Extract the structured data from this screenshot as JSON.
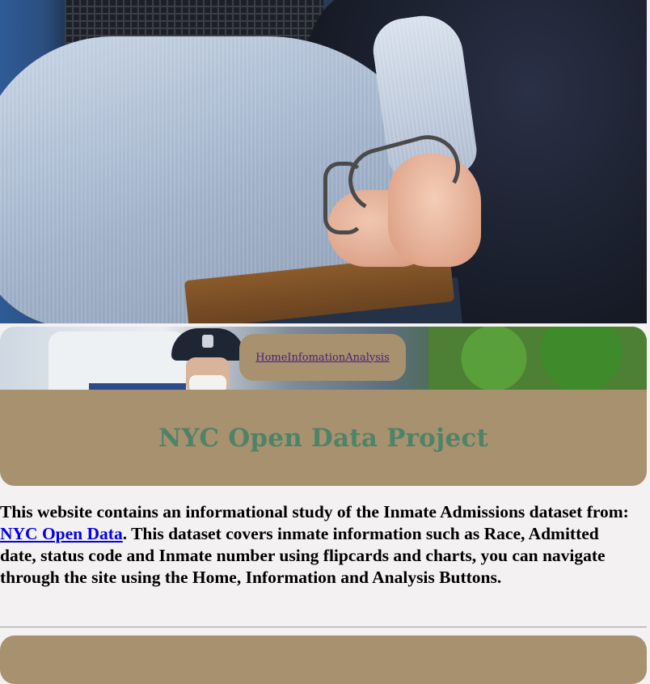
{
  "nav": {
    "links": [
      "Home",
      "Infomation",
      "Analysis"
    ]
  },
  "header": {
    "title": "NYC Open Data Project"
  },
  "intro": {
    "before_link": "This website contains an informational study of the Inmate Admissions dataset from: ",
    "link_text": "NYC Open Data",
    "after_link": ". This dataset covers inmate information such as Race, Admitted date, status code and Inmate number using flipcards and charts, you can navigate through the site using the Home, Information and Analysis Buttons."
  },
  "colors": {
    "background": "#f3f1f1",
    "panel": "#a8916f",
    "title_text": "#4f8368",
    "nav_link": "#4b1b7f",
    "body_link": "#0000ee"
  },
  "images": {
    "hero": "arrest-photo",
    "nav_banner": "police-street-photo"
  }
}
